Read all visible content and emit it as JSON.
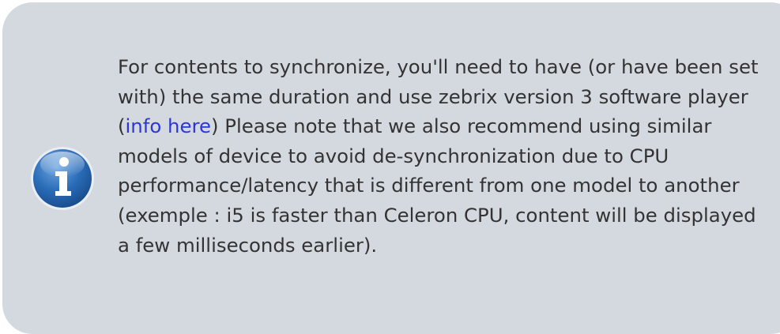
{
  "notice": {
    "icon": "info-icon",
    "text_before_link": "For contents to synchronize, you'll need to have (or have been set with) the same duration and use zebrix version 3 software player (",
    "link_text": "info here",
    "text_after_link": ") Please note that we also recommend using similar models of device to avoid de-synchronization due to CPU performance/latency that is different from one model to another (exemple : i5 is faster than Celeron CPU, content will be displayed a few milliseconds earlier).",
    "colors": {
      "background": "#d4d9e0",
      "text": "#333333",
      "link": "#2b36d9",
      "icon_blue": "#1f5fa8"
    }
  }
}
